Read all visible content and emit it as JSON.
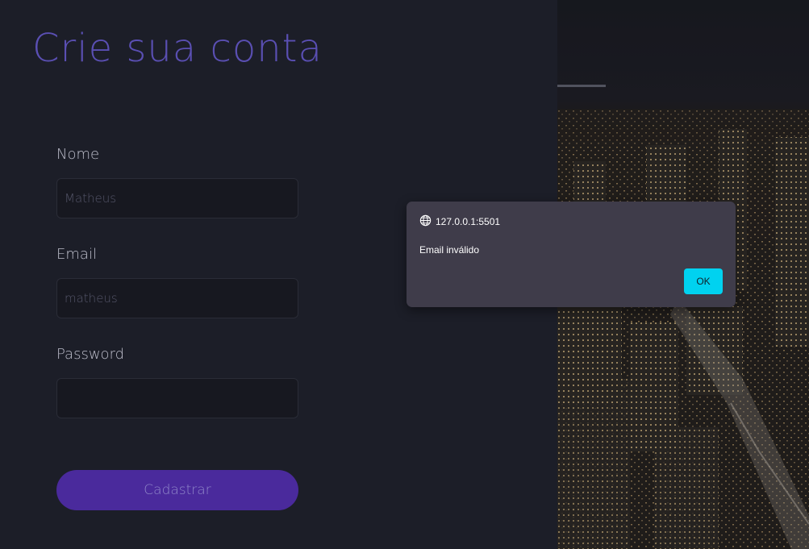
{
  "form": {
    "title": "Crie sua conta",
    "name_label": "Nome",
    "name_value": "Matheus",
    "email_label": "Email",
    "email_value": "matheus",
    "password_label": "Password",
    "password_value": "",
    "submit_label": "Cadastrar"
  },
  "alert": {
    "origin": "127.0.0.1:5501",
    "origin_icon": "globe-icon",
    "message": "Email inválido",
    "ok_label": "OK"
  },
  "colors": {
    "background": "#1c1e28",
    "title": "#5a4fb3",
    "submit": "#4a2a9c",
    "alert_bg": "#3f3c4a",
    "ok_button": "#00d2f0"
  }
}
